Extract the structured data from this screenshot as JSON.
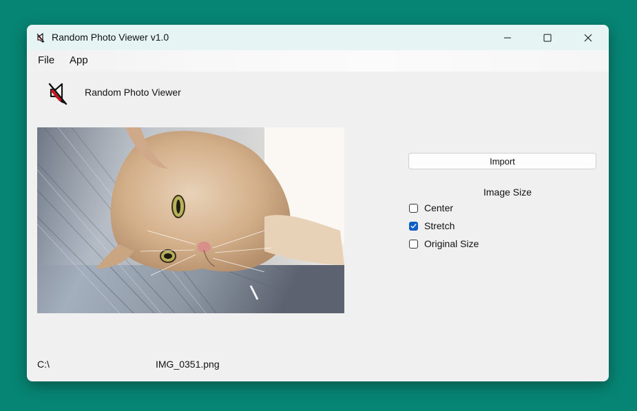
{
  "window": {
    "title": "Random Photo Viewer v1.0",
    "icon": "app-icon",
    "controls": [
      "minimize-icon",
      "maximize-icon",
      "close-icon"
    ]
  },
  "menu": {
    "items": [
      {
        "label": "File"
      },
      {
        "label": "App"
      }
    ]
  },
  "header": {
    "title": "Random Photo Viewer",
    "logo_icon": "speaker-mute-icon"
  },
  "photo": {
    "subject": "cat-photo"
  },
  "controls": {
    "import_label": "Import",
    "image_size_label": "Image Size",
    "options": [
      {
        "label": "Center",
        "checked": false
      },
      {
        "label": "Stretch",
        "checked": true
      },
      {
        "label": "Original Size",
        "checked": false
      }
    ]
  },
  "status": {
    "path": "C:\\",
    "filename": "IMG_0351.png"
  },
  "colors": {
    "desktop": "#078574",
    "titlebar": "#e6f5f4",
    "window": "#f0f0f0",
    "accent": "#0a5ec5"
  }
}
